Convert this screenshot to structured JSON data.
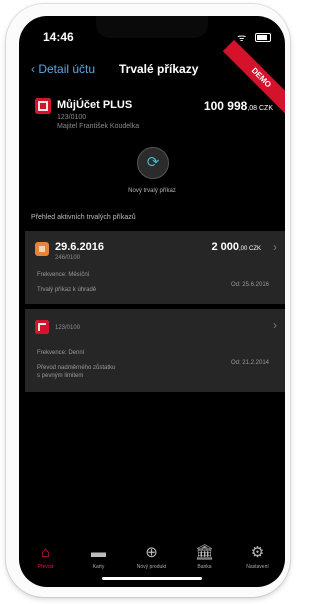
{
  "status_bar": {
    "time": "14:46",
    "icons": "wifi battery"
  },
  "nav": {
    "back_label": "Detail účtu",
    "title": "Trvalé příkazy",
    "badge": "DEMO"
  },
  "account": {
    "name": "MůjÚčet PLUS",
    "number": "123/0100",
    "owner": "Majitel František Koudelka",
    "balance_main": "100 998",
    "balance_dec": ",08 CZK"
  },
  "new_order": {
    "label": "Nový trvalý příkaz",
    "icon": "calendar-add-icon"
  },
  "section_title": "Přehled aktivních trvalých příkazů",
  "orders": [
    {
      "title": "29.6.2016",
      "account": "246/0100",
      "frequency": "Frekvence: Měsíční",
      "status": "Trvalý příkaz k úhradě",
      "since": "Od: 25.6.2016",
      "amount_main": "2 000",
      "amount_dec": ",00 CZK"
    },
    {
      "account": "123/0100",
      "frequency": "Frekvence: Denní",
      "status_line1": "Převod nadměrného zůstatku",
      "status_line2": "s pevným limitem",
      "since": "Od: 21.2.2014"
    }
  ],
  "tabbar": {
    "tabs": [
      {
        "label": "Převod",
        "icon": "home-icon",
        "active": true
      },
      {
        "label": "Karty",
        "icon": "card-icon",
        "active": false
      },
      {
        "label": "Nový produkt",
        "icon": "plus-icon",
        "active": false
      },
      {
        "label": "Banka",
        "icon": "bank-icon",
        "active": false
      },
      {
        "label": "Nastavení",
        "icon": "gear-icon",
        "active": false
      }
    ]
  },
  "colors": {
    "accent": "#e8154c",
    "brand_red": "#d4122b",
    "link": "#5aa9e6"
  }
}
